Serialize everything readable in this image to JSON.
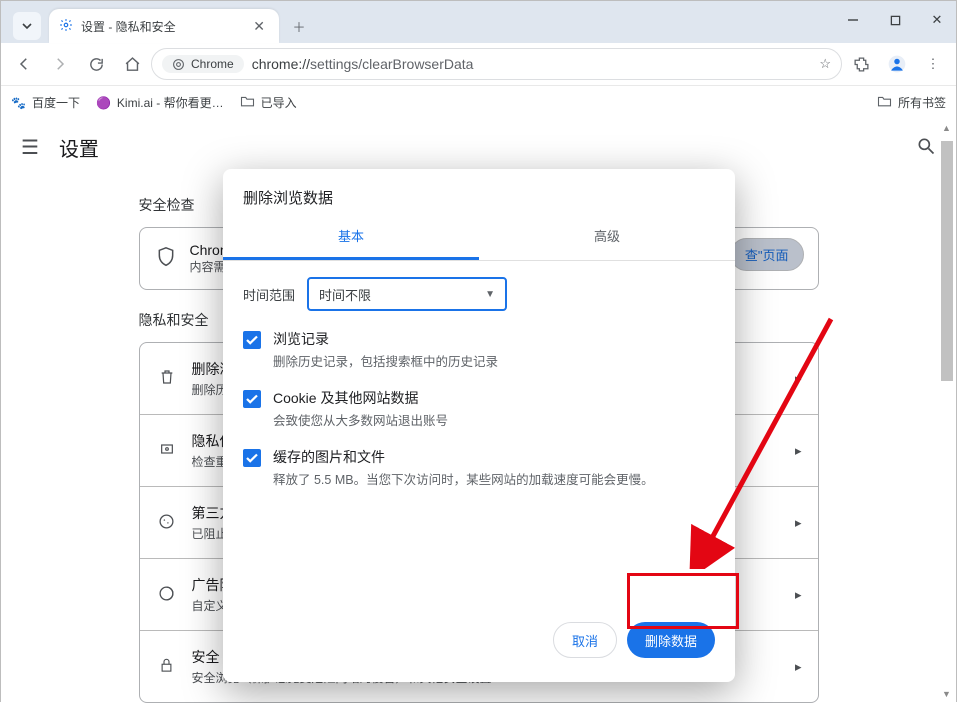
{
  "window": {
    "tab_title": "设置 - 隐私和安全"
  },
  "url": {
    "chip": "Chrome",
    "host": "chrome://",
    "path": "settings/clearBrowserData"
  },
  "bookmarks": {
    "items": [
      "百度一下",
      "Kimi.ai - 帮你看更…",
      "已导入"
    ],
    "all": "所有书签"
  },
  "settings": {
    "title": "设置",
    "section1": "安全检查",
    "notice_line1": "Chrome",
    "notice_line2": "内容需",
    "notice_btn": "查\"页面",
    "section2": "隐私和安全",
    "rows": [
      {
        "title": "删除浏",
        "sub": "删除历"
      },
      {
        "title": "隐私保",
        "sub": "检查重"
      },
      {
        "title": "第三方",
        "sub": "已阻止"
      },
      {
        "title": "广告隐",
        "sub": "自定义"
      },
      {
        "title": "安全",
        "sub": "安全浏览（保护您免受危险网站的侵害）和其他安全设置"
      }
    ]
  },
  "dialog": {
    "title": "删除浏览数据",
    "tabs": {
      "basic": "基本",
      "advanced": "高级"
    },
    "time_range_label": "时间范围",
    "time_range_value": "时间不限",
    "items": [
      {
        "title": "浏览记录",
        "sub": "删除历史记录，包括搜索框中的历史记录"
      },
      {
        "title": "Cookie 及其他网站数据",
        "sub": "会致使您从大多数网站退出账号"
      },
      {
        "title": "缓存的图片和文件",
        "sub": "释放了 5.5 MB。当您下次访问时，某些网站的加载速度可能会更慢。"
      }
    ],
    "cancel": "取消",
    "confirm": "删除数据"
  }
}
